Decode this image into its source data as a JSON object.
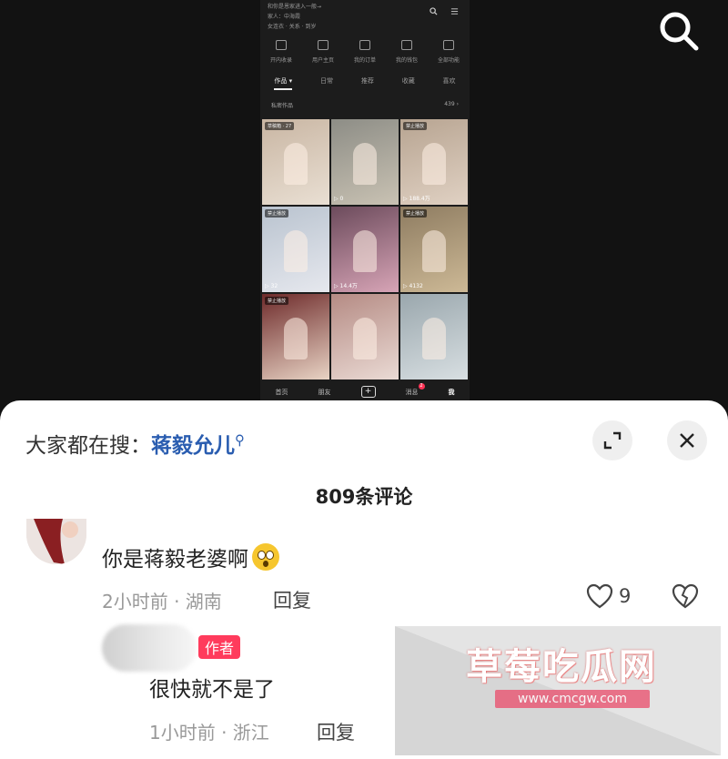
{
  "phone": {
    "header_line1": "和你是恩家进入一般→",
    "header_line2": "家人：中海霞",
    "header_line3": "女连衣 · 关系 · 到岁",
    "actions": [
      "开内收录",
      "用户主页",
      "我的订单",
      "我的钱包",
      "全部功能"
    ],
    "tabs": [
      "作品 ▾",
      "日常",
      "推荐",
      "收藏",
      "喜欢"
    ],
    "private_label": "私密作品",
    "private_count": "439 ›",
    "tiles": [
      {
        "badge": "草稿箱 · 27",
        "count": "",
        "colors": [
          "#c9b6a3",
          "#e9dfd3"
        ]
      },
      {
        "badge": "",
        "count": "▷ 0",
        "colors": [
          "#8d8d86",
          "#c9c2b3"
        ]
      },
      {
        "badge": "禁止播放",
        "count": "▷ 188.4万",
        "colors": [
          "#b7a491",
          "#e0d1c3"
        ]
      },
      {
        "badge": "禁止播放",
        "count": "▷ 32",
        "colors": [
          "#b9c3cf",
          "#e6e8ee"
        ]
      },
      {
        "badge": "",
        "count": "▷ 14.4万",
        "colors": [
          "#6c4b5c",
          "#d7a4b6"
        ]
      },
      {
        "badge": "禁止播放",
        "count": "▷ 4132",
        "colors": [
          "#8e7c61",
          "#cdb996"
        ]
      },
      {
        "badge": "禁止播放",
        "count": "",
        "colors": [
          "#6e2b2b",
          "#e8d3c4"
        ]
      },
      {
        "badge": "",
        "count": "",
        "colors": [
          "#b58b84",
          "#eadad4"
        ]
      },
      {
        "badge": "",
        "count": "",
        "colors": [
          "#9aa7ad",
          "#d8dfe2"
        ]
      }
    ],
    "bottom_nav": {
      "home": "首页",
      "friends": "朋友",
      "plus": "+",
      "messages": "消息",
      "msg_badge": "2",
      "me": "我"
    }
  },
  "panel": {
    "search_prefix": "大家都在搜：",
    "search_keyword": "蒋毅允儿",
    "comment_count_title": "809条评论",
    "comment1": {
      "text": "你是蒋毅老婆啊",
      "meta": "2小时前 · 湖南",
      "reply_label": "回复",
      "likes": "9"
    },
    "reply1": {
      "author_badge": "作者",
      "text": "很快就不是了",
      "meta": "1小时前 · 浙江",
      "reply_label": "回复"
    }
  },
  "watermark": {
    "logo": "草莓吃瓜网",
    "url": "www.cmcgw.com"
  },
  "colors": {
    "keyword": "#2a5db0",
    "author_badge": "#ff3b5c",
    "watermark_url_bg": "#e95572"
  }
}
